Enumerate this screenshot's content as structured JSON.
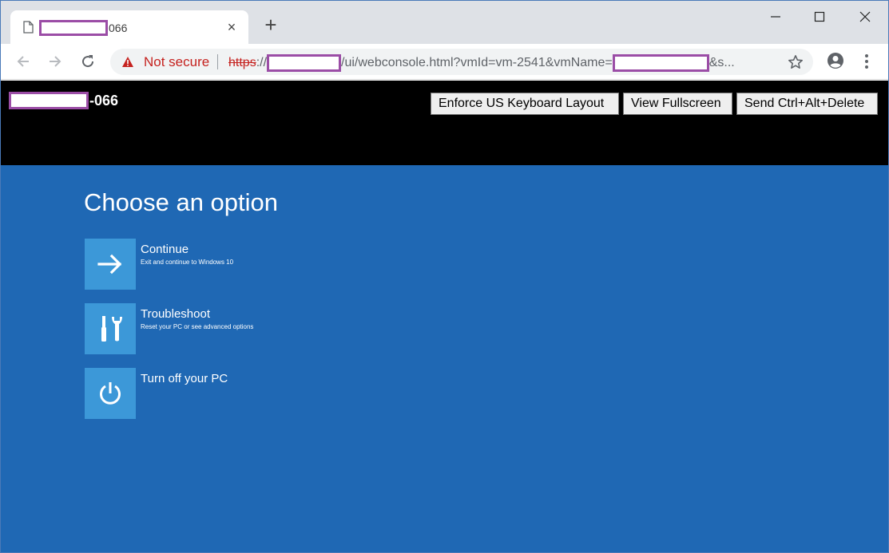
{
  "browser": {
    "tab": {
      "title_suffix": "066",
      "close_glyph": "×"
    },
    "new_tab_glyph": "+",
    "address": {
      "security_label": "Not secure",
      "scheme": "https",
      "scheme_sep": "://",
      "path": "/ui/webconsole.html?vmId=vm-2541&vmName=",
      "tail": "&s..."
    }
  },
  "console": {
    "title_suffix": "-066",
    "buttons": {
      "keyboard": "Enforce US Keyboard Layout",
      "fullscreen": "View Fullscreen",
      "cad": "Send Ctrl+Alt+Delete"
    }
  },
  "recovery": {
    "heading": "Choose an option",
    "options": [
      {
        "label": "Continue",
        "description": "Exit and continue to Windows 10",
        "icon": "arrow-right-icon"
      },
      {
        "label": "Troubleshoot",
        "description": "Reset your PC or see advanced options",
        "icon": "tools-icon"
      },
      {
        "label": "Turn off your PC",
        "description": "",
        "icon": "power-icon"
      }
    ]
  },
  "colors": {
    "recovery_bg": "#1f68b4",
    "tile_bg": "#3c98d8",
    "redaction": "#9b4da6",
    "warning_red": "#c5221f"
  }
}
